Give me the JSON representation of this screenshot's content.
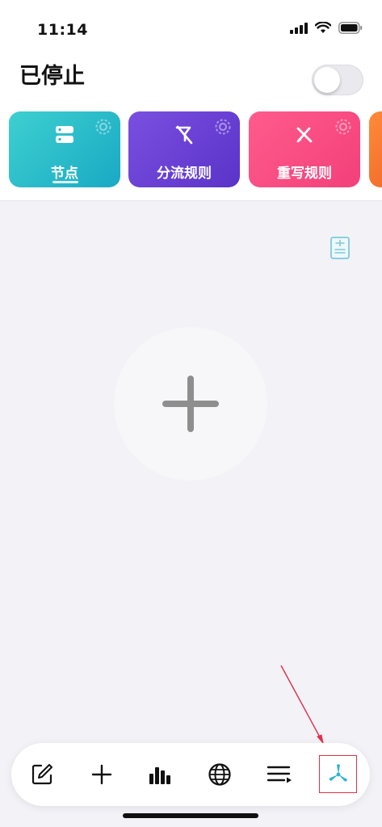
{
  "status_bar": {
    "time": "11:14",
    "icons": [
      "cellular-signal-icon",
      "wifi-icon",
      "battery-icon"
    ]
  },
  "header": {
    "title": "已停止",
    "toggle_on": false
  },
  "cards": [
    {
      "label": "节点",
      "icon": "server-icon",
      "active": true,
      "color_start": "#3dd0d0",
      "color_end": "#1aa9c4"
    },
    {
      "label": "分流规则",
      "icon": "split-routing-icon",
      "active": false,
      "color_start": "#7a4fe0",
      "color_end": "#5a33c8"
    },
    {
      "label": "重写规则",
      "icon": "rewrite-pencil-icon",
      "active": false,
      "color_start": "#ff5b8c",
      "color_end": "#f3407a"
    },
    {
      "label": "",
      "icon": "",
      "active": false,
      "color_start": "#ff8a3a",
      "color_end": "#f06a2a"
    }
  ],
  "main": {
    "doc_icon": "document-icon",
    "add_icon": "plus-icon"
  },
  "tab_bar": {
    "items": [
      {
        "name": "edit",
        "icon": "edit-icon"
      },
      {
        "name": "add",
        "icon": "plus-icon"
      },
      {
        "name": "stats",
        "icon": "bar-chart-icon"
      },
      {
        "name": "web",
        "icon": "globe-icon"
      },
      {
        "name": "list",
        "icon": "list-icon"
      },
      {
        "name": "app",
        "icon": "tri-blade-icon"
      }
    ],
    "highlight_color": "#e0304a"
  }
}
